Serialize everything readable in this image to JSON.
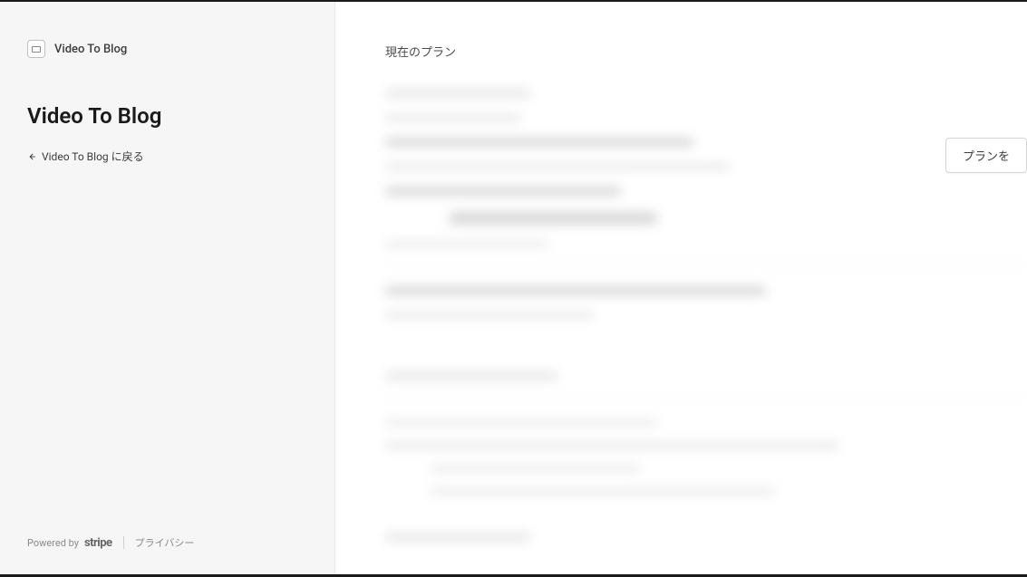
{
  "brand": {
    "name": "Video To Blog"
  },
  "sidebar": {
    "title": "Video To Blog",
    "back_link": "Video To Blog に戻る",
    "footer": {
      "powered_by": "Powered by",
      "stripe": "stripe",
      "privacy": "プライバシー"
    }
  },
  "main": {
    "section_header": "現在のプラン",
    "plan_button": "プランを"
  }
}
